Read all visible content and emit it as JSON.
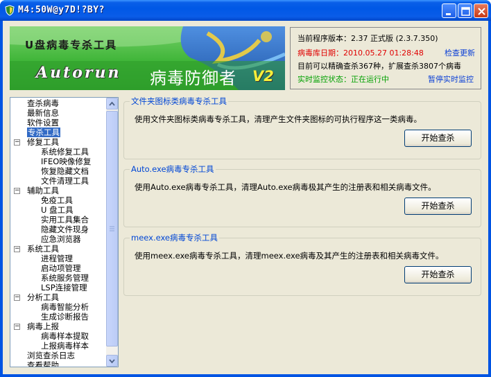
{
  "window": {
    "title": "M4:50W@y7D!?BY?",
    "icon": "shield-icon",
    "controls": [
      "minimize",
      "maximize",
      "close"
    ]
  },
  "banner": {
    "title": "U盘病毒专杀工具",
    "autorun": "Autorun",
    "defender": "病毒防御者",
    "version_badge": "V2"
  },
  "info": {
    "version_label": "当前程序版本：2.37 正式版 (2.3.7.350)",
    "db_date": "病毒库日期：2010.05.27 01:28:48",
    "check_update": "检查更新",
    "capability": "目前可以精确查杀367种，扩展查杀3807个病毒",
    "monitor_status": "实时监控状态：正在运行中",
    "pause_monitor": "暂停实时监控"
  },
  "tree": {
    "items": [
      {
        "label": "查杀病毒",
        "level": 0,
        "expander": null,
        "selected": false
      },
      {
        "label": "最新信息",
        "level": 0,
        "expander": null,
        "selected": false
      },
      {
        "label": "软件设置",
        "level": 0,
        "expander": null,
        "selected": false
      },
      {
        "label": "专杀工具",
        "level": 0,
        "expander": null,
        "selected": true
      },
      {
        "label": "修复工具",
        "level": 0,
        "expander": "-",
        "selected": false
      },
      {
        "label": "系统修复工具",
        "level": 1,
        "expander": null,
        "selected": false
      },
      {
        "label": "IFEO映像修复",
        "level": 1,
        "expander": null,
        "selected": false
      },
      {
        "label": "恢复隐藏文档",
        "level": 1,
        "expander": null,
        "selected": false
      },
      {
        "label": "文件清理工具",
        "level": 1,
        "expander": null,
        "selected": false
      },
      {
        "label": "辅助工具",
        "level": 0,
        "expander": "-",
        "selected": false
      },
      {
        "label": "免疫工具",
        "level": 1,
        "expander": null,
        "selected": false
      },
      {
        "label": "U 盘工具",
        "level": 1,
        "expander": null,
        "selected": false
      },
      {
        "label": "实用工具集合",
        "level": 1,
        "expander": null,
        "selected": false
      },
      {
        "label": "隐藏文件现身",
        "level": 1,
        "expander": null,
        "selected": false
      },
      {
        "label": "应急浏览器",
        "level": 1,
        "expander": null,
        "selected": false
      },
      {
        "label": "系统工具",
        "level": 0,
        "expander": "-",
        "selected": false
      },
      {
        "label": "进程管理",
        "level": 1,
        "expander": null,
        "selected": false
      },
      {
        "label": "启动项管理",
        "level": 1,
        "expander": null,
        "selected": false
      },
      {
        "label": "系统服务管理",
        "level": 1,
        "expander": null,
        "selected": false
      },
      {
        "label": "LSP连接管理",
        "level": 1,
        "expander": null,
        "selected": false
      },
      {
        "label": "分析工具",
        "level": 0,
        "expander": "-",
        "selected": false
      },
      {
        "label": "病毒智能分析",
        "level": 1,
        "expander": null,
        "selected": false
      },
      {
        "label": "生成诊断报告",
        "level": 1,
        "expander": null,
        "selected": false
      },
      {
        "label": "病毒上报",
        "level": 0,
        "expander": "-",
        "selected": false
      },
      {
        "label": "病毒样本提取",
        "level": 1,
        "expander": null,
        "selected": false
      },
      {
        "label": "上报病毒样本",
        "level": 1,
        "expander": null,
        "selected": false
      },
      {
        "label": "浏览查杀日志",
        "level": 0,
        "expander": null,
        "selected": false
      },
      {
        "label": "查看帮助",
        "level": 0,
        "expander": null,
        "selected": false
      }
    ]
  },
  "tools": [
    {
      "title": "文件夹图标类病毒专杀工具",
      "description": "使用文件夹图标类病毒专杀工具，清理产生文件夹图标的可执行程序这一类病毒。",
      "button": "开始查杀"
    },
    {
      "title": "Auto.exe病毒专杀工具",
      "description": "使用Auto.exe病毒专杀工具，清理Auto.exe病毒极其产生的注册表和相关病毒文件。",
      "button": "开始查杀"
    },
    {
      "title": "meex.exe病毒专杀工具",
      "description": "使用meex.exe病毒专杀工具，清理meex.exe病毒及其产生的注册表和相关病毒文件。",
      "button": "开始查杀"
    }
  ],
  "colors": {
    "titlebar": "#0058e6",
    "client_bg": "#ece9d8",
    "banner_green": "#3fb538",
    "banner_blue": "#1f56a8",
    "selection": "#316ac5",
    "group_title": "#0046d5",
    "status_red": "#e00000",
    "status_green": "#00a000"
  }
}
